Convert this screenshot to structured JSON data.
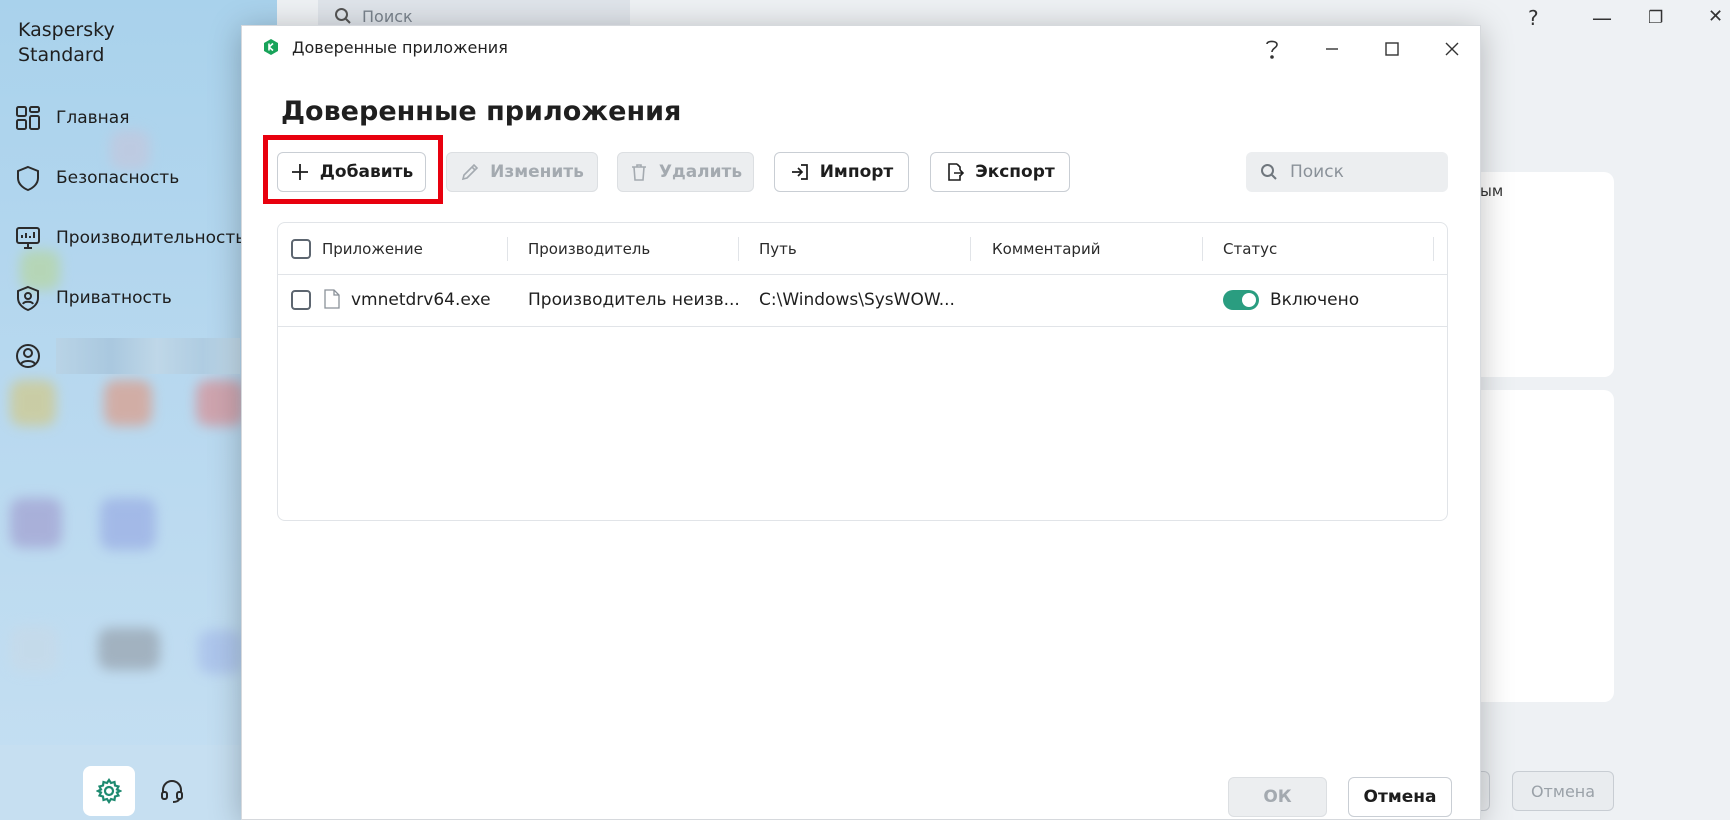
{
  "background_app": {
    "brand_line1": "Kaspersky",
    "brand_line2": "Standard",
    "nav": [
      {
        "label": "Главная",
        "icon": "grid-icon"
      },
      {
        "label": "Безопасность",
        "icon": "shield-icon"
      },
      {
        "label": "Производительность",
        "icon": "monitor-icon"
      },
      {
        "label": "Приватность",
        "icon": "privacy-shield-icon"
      }
    ],
    "search_placeholder": "Поиск",
    "window_controls": [
      "?",
      "—",
      "❐",
      "✕"
    ],
    "card_snippet": "ым",
    "cancel_label": "Отмена",
    "accent": "#1e8a70"
  },
  "dialog": {
    "title": "Доверенные приложения",
    "heading": "Доверенные приложения",
    "toolbar": {
      "add": "Добавить",
      "edit": "Изменить",
      "delete": "Удалить",
      "import": "Импорт",
      "export": "Экспорт"
    },
    "search_placeholder": "Поиск",
    "table": {
      "columns": [
        "Приложение",
        "Производитель",
        "Путь",
        "Комментарий",
        "Статус"
      ],
      "rows": [
        {
          "app": "vmnetdrv64.exe",
          "vendor": "Производитель неизв...",
          "path": "C:\\Windows\\SysWOW...",
          "comment": "",
          "status": "Включено",
          "enabled": true
        }
      ]
    },
    "footer": {
      "ok": "ОК",
      "cancel": "Отмена"
    },
    "colors": {
      "highlight": "#e8000e",
      "toggle_on": "#2a9d80"
    }
  }
}
